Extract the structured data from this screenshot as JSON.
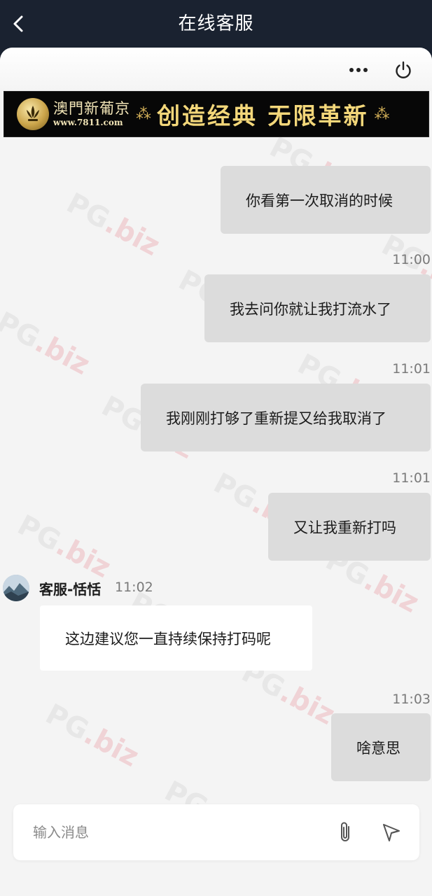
{
  "header": {
    "title": "在线客服"
  },
  "panel": {
    "banner": {
      "brand": "澳門新葡京",
      "url": "www.7811.com",
      "slogan": "创造经典 无限革新"
    }
  },
  "messages": [
    {
      "side": "right",
      "text": "你看第一次取消的时候",
      "time": "11:00"
    },
    {
      "side": "right",
      "text": "我去问你就让我打流水了",
      "time": "11:01"
    },
    {
      "side": "right",
      "text": "我刚刚打够了重新提又给我取消了",
      "time": "11:01"
    },
    {
      "side": "right",
      "text": "又让我重新打吗",
      "time": ""
    },
    {
      "side": "left",
      "sender": "客服-恬恬",
      "time": "11:02",
      "text": "这边建议您一直持续保持打码呢"
    },
    {
      "side": "right",
      "text": "啥意思",
      "time": "11:03"
    }
  ],
  "composer": {
    "placeholder": "输入消息"
  },
  "watermark": {
    "text": "PG",
    "suffix": ".biz"
  },
  "colors": {
    "header_bg": "#1a2230",
    "chat_bg": "#f4f4f4",
    "my_bubble": "#dcdcdc",
    "agent_bubble": "#ffffff"
  },
  "icons": [
    "back-icon",
    "more-icon",
    "power-icon",
    "attach-icon",
    "send-icon"
  ]
}
